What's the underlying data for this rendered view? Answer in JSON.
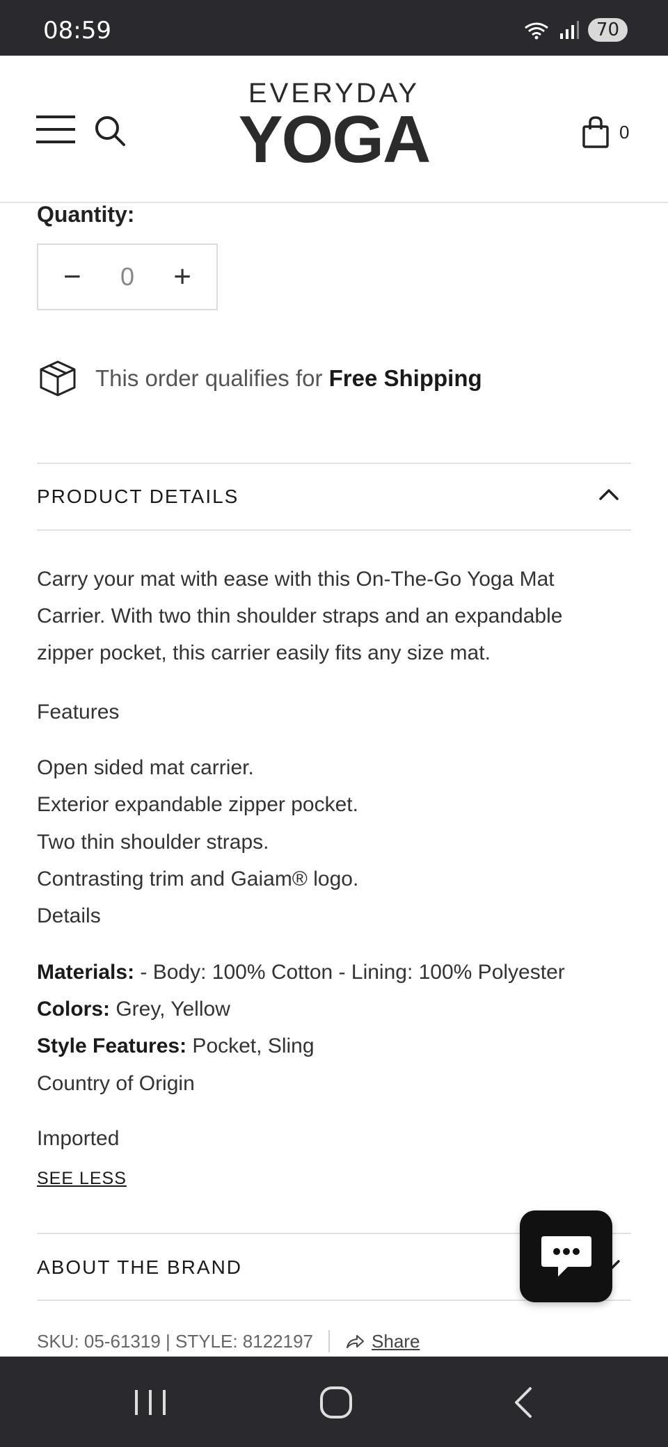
{
  "status_bar": {
    "time": "08:59",
    "battery": "70"
  },
  "header": {
    "logo_top": "EVERYDAY",
    "logo_bottom": "YOGA",
    "cart_count": "0"
  },
  "quantity": {
    "label": "Quantity:",
    "value": "0"
  },
  "shipping": {
    "text": "This order qualifies for ",
    "bold": "Free Shipping"
  },
  "product_details": {
    "title": "PRODUCT DETAILS",
    "description": "Carry your mat with ease with this On-The-Go Yoga Mat Carrier. With two thin shoulder straps and an expandable zipper pocket, this carrier easily fits any size mat.",
    "features_heading": "Features",
    "features": [
      "Open sided mat carrier.",
      "Exterior expandable zipper pocket.",
      "Two thin shoulder straps.",
      "Contrasting trim and Gaiam® logo.",
      "Details"
    ],
    "specs": [
      {
        "label": "Materials:",
        "value": " - Body: 100% Cotton - Lining: 100% Polyester"
      },
      {
        "label": "Colors:",
        "value": " Grey, Yellow"
      },
      {
        "label": "Style Features:",
        "value": " Pocket, Sling"
      }
    ],
    "origin_label": "Country of Origin",
    "origin_value": "Imported",
    "see_less": "SEE LESS"
  },
  "about_brand": {
    "title": "ABOUT THE BRAND"
  },
  "sku": {
    "text": "SKU: 05-61319 | STYLE: 8122197",
    "share": "Share"
  }
}
